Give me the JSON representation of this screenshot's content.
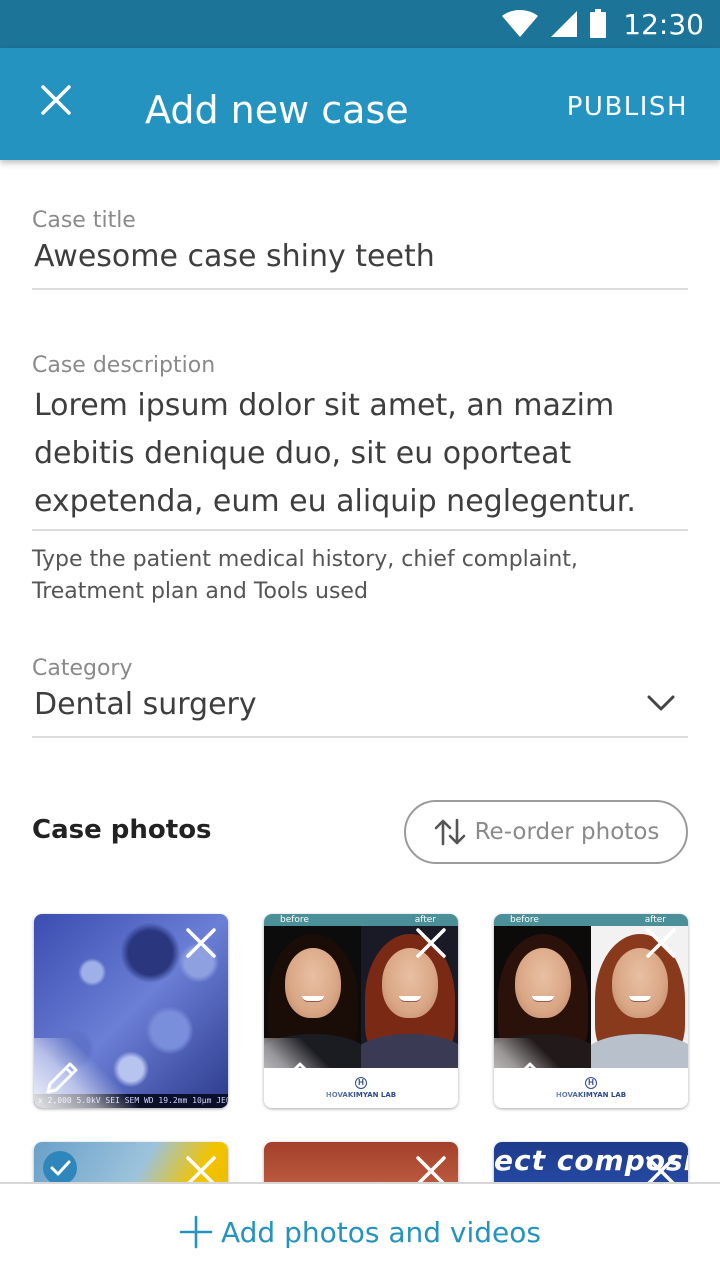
{
  "status_bar": {
    "time": "12:30",
    "icons": [
      "wifi-icon",
      "signal-icon",
      "battery-icon"
    ]
  },
  "app_bar": {
    "title": "Add new case",
    "action_label": "PUBLISH",
    "close_icon": "close-icon"
  },
  "form": {
    "case_title": {
      "label": "Case title",
      "value": "Awesome case shiny teeth"
    },
    "case_description": {
      "label": "Case description",
      "value": "Lorem ipsum dolor sit amet, an mazim debitis denique duo, sit eu oporteat expetenda, eum eu aliquip neglegentur.",
      "helper": "Type the patient medical history, chief complaint, Treatment plan and Tools used"
    },
    "category": {
      "label": "Category",
      "value": "Dental surgery"
    }
  },
  "photos": {
    "heading": "Case photos",
    "reorder_label": "Re-order photos",
    "items": [
      {
        "kind": "micrograph",
        "caption": "x 2,000   5.0kV  SEI  SEM  WD 19.2mm  10µm  JEOL"
      },
      {
        "kind": "before-after",
        "before": "before",
        "after": "after",
        "brand": "HOVAKIMYAN LAB",
        "logo": "H"
      },
      {
        "kind": "before-after",
        "before": "before",
        "after": "after",
        "brand": "HOVAKIMYAN LAB",
        "logo": "H"
      },
      {
        "kind": "teeth-yellow",
        "selected": true
      },
      {
        "kind": "teeth-red"
      },
      {
        "kind": "text-banner",
        "text": "ect composite"
      }
    ]
  },
  "bottom_bar": {
    "add_label": "Add photos and videos"
  },
  "colors": {
    "status_bar": "#1c7599",
    "app_bar": "#2593c0",
    "accent": "#2593c0",
    "selected_check": "#2e86ba"
  }
}
